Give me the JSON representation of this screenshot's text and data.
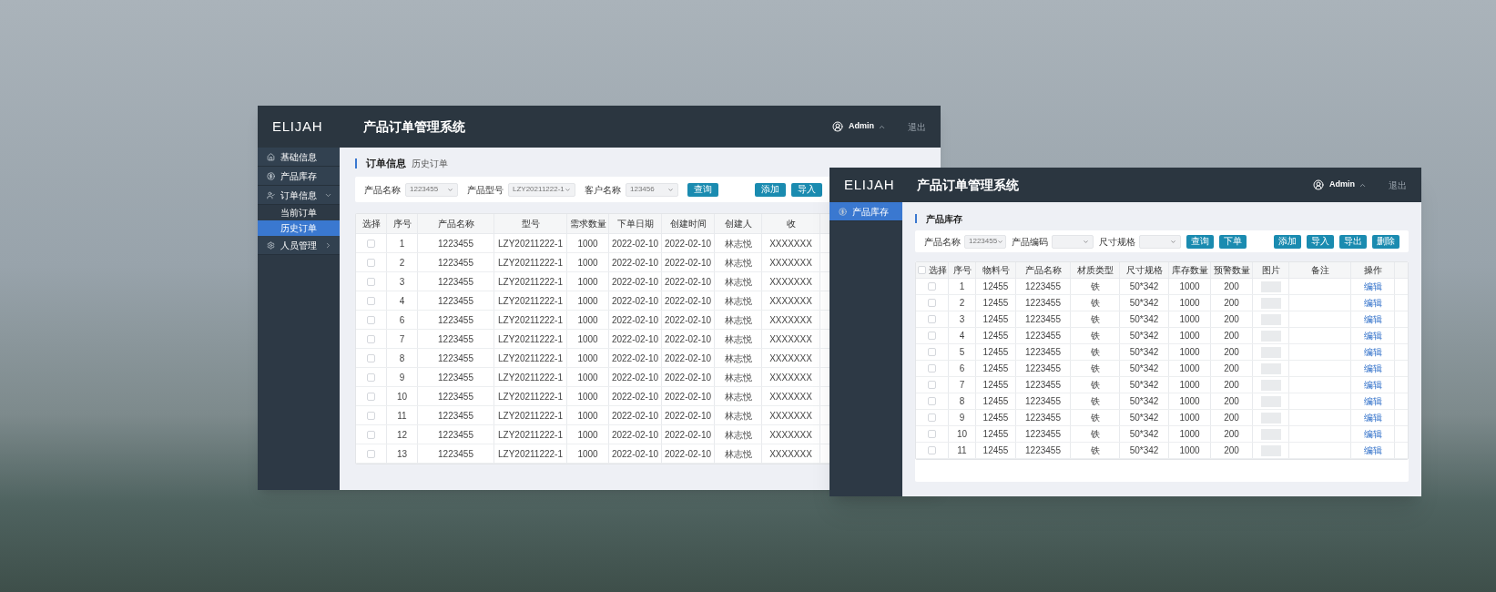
{
  "order_window": {
    "logo": "ELIJAH",
    "title": "产品订单管理系统",
    "user": "Admin",
    "logout": "退出",
    "sidebar": [
      {
        "label": "基础信息",
        "selected": false
      },
      {
        "label": "产品库存",
        "selected": false
      },
      {
        "label": "订单信息",
        "selected": false,
        "expanded": true,
        "children": [
          {
            "label": "当前订单",
            "selected": false
          },
          {
            "label": "历史订单",
            "selected": true
          }
        ]
      },
      {
        "label": "人员管理",
        "selected": false,
        "expanded": false
      }
    ],
    "page_title": "订单信息",
    "page_subtitle": "历史订单",
    "filters": [
      {
        "label": "产品名称",
        "value": "1223455"
      },
      {
        "label": "产品型号",
        "value": "LZY20211222-1"
      },
      {
        "label": "客户名称",
        "value": "123456"
      }
    ],
    "search_buttons": [
      "查询"
    ],
    "action_buttons": [
      "添加",
      "导入"
    ],
    "table": {
      "select_column": "选择",
      "columns": [
        {
          "label": "序号",
          "kind": "text"
        },
        {
          "label": "产品名称",
          "kind": "text"
        },
        {
          "label": "型号",
          "kind": "text"
        },
        {
          "label": "需求数量",
          "kind": "text"
        },
        {
          "label": "下单日期",
          "kind": "text"
        },
        {
          "label": "创建时间",
          "kind": "text"
        },
        {
          "label": "创建人",
          "kind": "text"
        },
        {
          "label": "收",
          "kind": "text"
        }
      ],
      "rows": [
        {
          "checked": false,
          "cells": [
            "1",
            "1223455",
            "LZY20211222-1",
            "1000",
            "2022-02-10",
            "2022-02-10",
            "林志悦",
            "XXXXXXX"
          ]
        },
        {
          "checked": false,
          "cells": [
            "2",
            "1223455",
            "LZY20211222-1",
            "1000",
            "2022-02-10",
            "2022-02-10",
            "林志悦",
            "XXXXXXX"
          ]
        },
        {
          "checked": false,
          "cells": [
            "3",
            "1223455",
            "LZY20211222-1",
            "1000",
            "2022-02-10",
            "2022-02-10",
            "林志悦",
            "XXXXXXX"
          ]
        },
        {
          "checked": false,
          "cells": [
            "4",
            "1223455",
            "LZY20211222-1",
            "1000",
            "2022-02-10",
            "2022-02-10",
            "林志悦",
            "XXXXXXX"
          ]
        },
        {
          "checked": false,
          "cells": [
            "6",
            "1223455",
            "LZY20211222-1",
            "1000",
            "2022-02-10",
            "2022-02-10",
            "林志悦",
            "XXXXXXX"
          ]
        },
        {
          "checked": false,
          "cells": [
            "7",
            "1223455",
            "LZY20211222-1",
            "1000",
            "2022-02-10",
            "2022-02-10",
            "林志悦",
            "XXXXXXX"
          ]
        },
        {
          "checked": false,
          "cells": [
            "8",
            "1223455",
            "LZY20211222-1",
            "1000",
            "2022-02-10",
            "2022-02-10",
            "林志悦",
            "XXXXXXX"
          ]
        },
        {
          "checked": false,
          "cells": [
            "9",
            "1223455",
            "LZY20211222-1",
            "1000",
            "2022-02-10",
            "2022-02-10",
            "林志悦",
            "XXXXXXX"
          ]
        },
        {
          "checked": false,
          "cells": [
            "10",
            "1223455",
            "LZY20211222-1",
            "1000",
            "2022-02-10",
            "2022-02-10",
            "林志悦",
            "XXXXXXX"
          ]
        },
        {
          "checked": false,
          "cells": [
            "11",
            "1223455",
            "LZY20211222-1",
            "1000",
            "2022-02-10",
            "2022-02-10",
            "林志悦",
            "XXXXXXX"
          ]
        },
        {
          "checked": false,
          "cells": [
            "12",
            "1223455",
            "LZY20211222-1",
            "1000",
            "2022-02-10",
            "2022-02-10",
            "林志悦",
            "XXXXXXX"
          ]
        },
        {
          "checked": false,
          "cells": [
            "13",
            "1223455",
            "LZY20211222-1",
            "1000",
            "2022-02-10",
            "2022-02-10",
            "林志悦",
            "XXXXXXX"
          ]
        }
      ]
    }
  },
  "inventory_window": {
    "logo": "ELIJAH",
    "title": "产品订单管理系统",
    "user": "Admin",
    "logout": "退出",
    "sidebar": [
      {
        "label": "产品库存",
        "selected": true
      }
    ],
    "page_title": "产品库存",
    "filters": [
      {
        "label": "产品名称",
        "value": "1223455"
      },
      {
        "label": "产品编码"
      },
      {
        "label": "尺寸规格"
      }
    ],
    "search_buttons": [
      "查询",
      "下单"
    ],
    "action_buttons": [
      "添加",
      "导入",
      "导出",
      "删除"
    ],
    "table": {
      "header_checked": false,
      "select_column": "选择",
      "columns": [
        {
          "label": "序号",
          "kind": "text"
        },
        {
          "label": "物料号",
          "kind": "text"
        },
        {
          "label": "产品名称",
          "kind": "text"
        },
        {
          "label": "材质类型",
          "kind": "text"
        },
        {
          "label": "尺寸规格",
          "kind": "text"
        },
        {
          "label": "库存数量",
          "kind": "text"
        },
        {
          "label": "预警数量",
          "kind": "text"
        },
        {
          "label": "图片",
          "kind": "image"
        },
        {
          "label": "备注",
          "kind": "remark"
        },
        {
          "label": "操作",
          "kind": "action"
        }
      ],
      "rows": [
        {
          "checked": false,
          "cells": [
            "1",
            "12455",
            "1223455",
            "铁",
            "50*342",
            "1000",
            "200"
          ],
          "action": "编辑"
        },
        {
          "checked": false,
          "cells": [
            "2",
            "12455",
            "1223455",
            "铁",
            "50*342",
            "1000",
            "200"
          ],
          "action": "编辑"
        },
        {
          "checked": false,
          "cells": [
            "3",
            "12455",
            "1223455",
            "铁",
            "50*342",
            "1000",
            "200"
          ],
          "action": "编辑"
        },
        {
          "checked": false,
          "cells": [
            "4",
            "12455",
            "1223455",
            "铁",
            "50*342",
            "1000",
            "200"
          ],
          "action": "编辑"
        },
        {
          "checked": false,
          "cells": [
            "5",
            "12455",
            "1223455",
            "铁",
            "50*342",
            "1000",
            "200"
          ],
          "action": "编辑"
        },
        {
          "checked": false,
          "cells": [
            "6",
            "12455",
            "1223455",
            "铁",
            "50*342",
            "1000",
            "200"
          ],
          "action": "编辑"
        },
        {
          "checked": false,
          "cells": [
            "7",
            "12455",
            "1223455",
            "铁",
            "50*342",
            "1000",
            "200"
          ],
          "action": "编辑"
        },
        {
          "checked": false,
          "cells": [
            "8",
            "12455",
            "1223455",
            "铁",
            "50*342",
            "1000",
            "200"
          ],
          "action": "编辑"
        },
        {
          "checked": false,
          "cells": [
            "9",
            "12455",
            "1223455",
            "铁",
            "50*342",
            "1000",
            "200"
          ],
          "action": "编辑"
        },
        {
          "checked": false,
          "cells": [
            "10",
            "12455",
            "1223455",
            "铁",
            "50*342",
            "1000",
            "200"
          ],
          "action": "编辑"
        },
        {
          "checked": false,
          "cells": [
            "11",
            "12455",
            "1223455",
            "铁",
            "50*342",
            "1000",
            "200"
          ],
          "action": "编辑"
        }
      ]
    }
  }
}
